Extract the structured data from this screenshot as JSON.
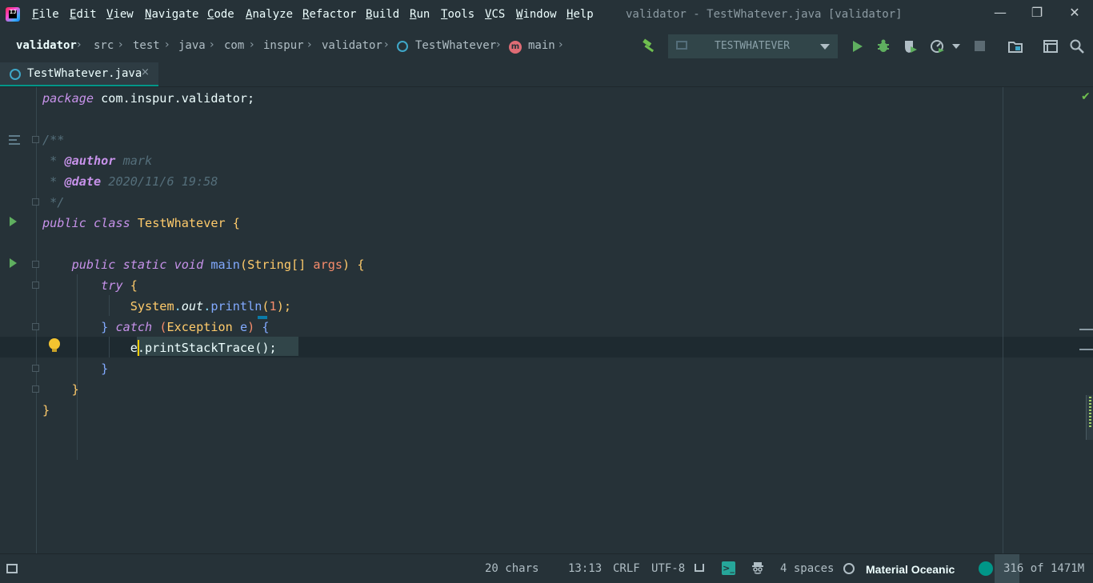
{
  "app": {
    "logo_letters": "IJ",
    "window_title": "validator - TestWhatever.java [validator]"
  },
  "menu": [
    "File",
    "Edit",
    "View",
    "Navigate",
    "Code",
    "Analyze",
    "Refactor",
    "Build",
    "Run",
    "Tools",
    "VCS",
    "Window",
    "Help"
  ],
  "window_controls": {
    "minimize": "—",
    "restore": "❐",
    "close": "✕"
  },
  "breadcrumbs": [
    "validator",
    "src",
    "test",
    "java",
    "com",
    "inspur",
    "validator",
    "TestWhatever",
    "main"
  ],
  "breadcrumb_icons": {
    "class": "class-icon",
    "method_letter": "m"
  },
  "toolbar": {
    "run_config": "TESTWHATEVER",
    "icons": [
      "build-hammer-icon",
      "run-config-icon",
      "run-icon",
      "debug-icon",
      "coverage-icon",
      "profile-icon",
      "stop-icon",
      "project-structure-icon",
      "presentation-icon",
      "search-everywhere-icon"
    ]
  },
  "tab": {
    "label": "TestWhatever.java",
    "close": "×"
  },
  "code": {
    "l1_kw": "package",
    "l1_rest": " com.inspur.validator;",
    "l3": "/**",
    "l4_star": " * ",
    "l4_tag": "@author",
    "l4_val": " mark",
    "l5_star": " * ",
    "l5_tag": "@date",
    "l5_val": " 2020/11/6 19:58",
    "l6": " */",
    "l7_kw1": "public",
    "l7_kw2": "class",
    "l7_name": "TestWhatever",
    "l7_brace": "{",
    "l9_kw1": "public",
    "l9_kw2": "static",
    "l9_kw3": "void",
    "l9_fn": "main",
    "l9_open": "(",
    "l9_type": "String[]",
    "l9_param": "args",
    "l9_close": ")",
    "l9_brace": "{",
    "l10_kw": "try",
    "l10_brace": "{",
    "l11_cls": "System",
    "l11_dot1": ".",
    "l11_field": "out",
    "l11_dot2": ".",
    "l11_fn": "println",
    "l11_open": "(",
    "l11_num": "1",
    "l11_close": ");",
    "l12_close": "}",
    "l12_kw": "catch",
    "l12_open": "(",
    "l12_type": "Exception",
    "l12_param": "e",
    "l12_close2": ")",
    "l12_brace": "{",
    "l13_var": "e",
    "l13_rest": ".printStackTrace();",
    "l14": "}",
    "l15": "}",
    "l16": "}"
  },
  "status": {
    "chars": "20 chars",
    "position": "13:13",
    "line_sep": "CRLF",
    "encoding": "UTF-8",
    "terminal_glyph": ">_",
    "indent": "4 spaces",
    "theme": "Material Oceanic",
    "memory": "316 of 1471M"
  },
  "colors": {
    "background": "#263238",
    "accent": "#009688",
    "keyword": "#c792ea",
    "class": "#ffcb6b",
    "function": "#82aaff",
    "number": "#f78c6c",
    "comment": "#546e7a"
  }
}
